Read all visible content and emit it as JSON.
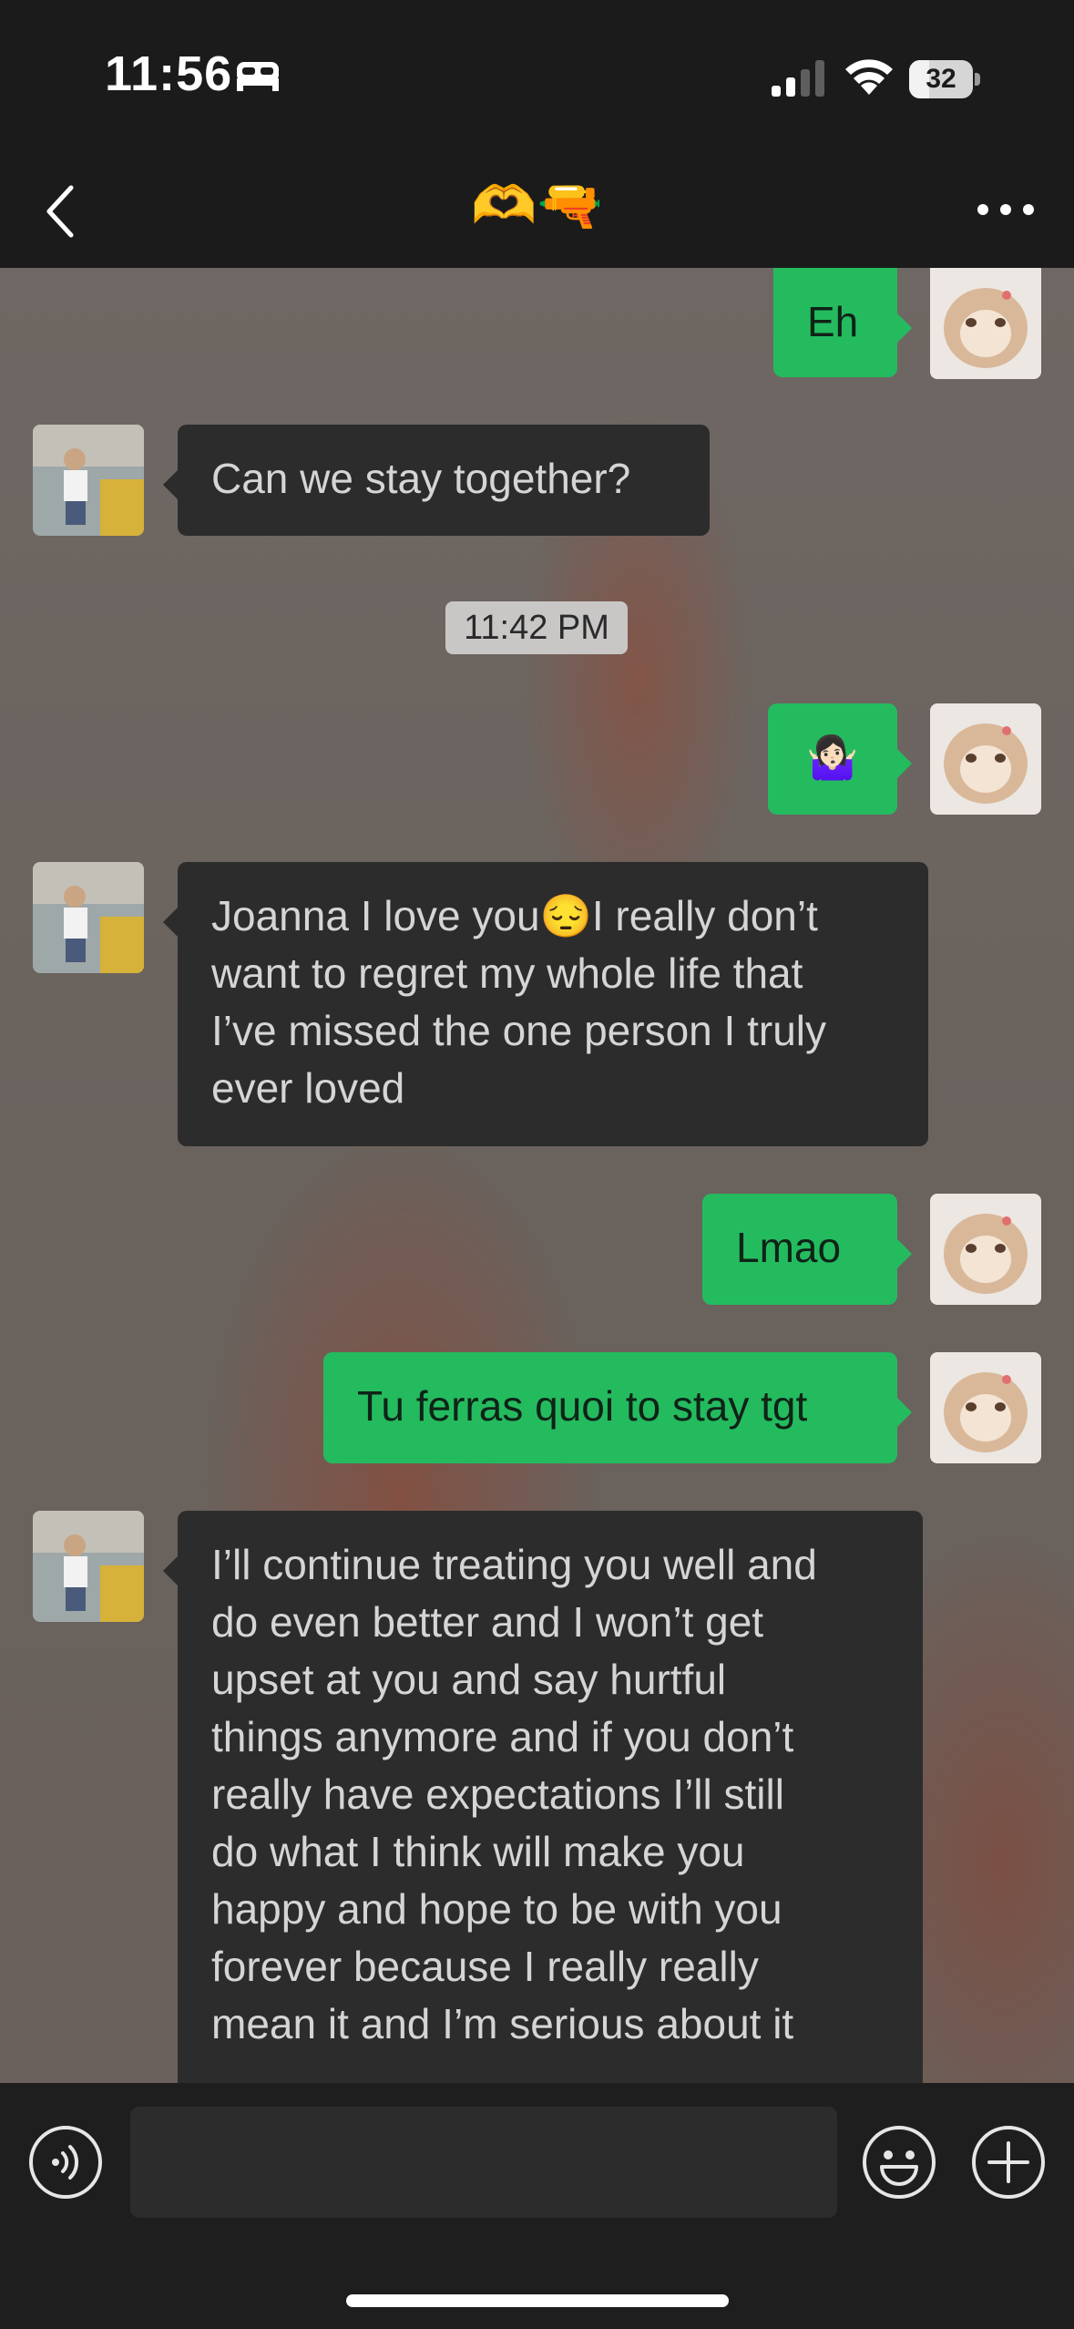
{
  "status_bar": {
    "time": "11:56",
    "battery": "32",
    "battery_percent": 32,
    "icons": [
      "bed-icon",
      "cellular-signal-icon",
      "wifi-icon",
      "battery-icon"
    ]
  },
  "nav": {
    "title": "🫶🔫",
    "back_icon": "chevron-left-icon",
    "more_icon": "more-dots-icon"
  },
  "messages": [
    {
      "from": "me",
      "text": "Eh"
    },
    {
      "from": "them",
      "text": "Can we stay together?"
    },
    {
      "type": "timestamp",
      "text": "11:42 PM"
    },
    {
      "from": "me",
      "text": "🤷🏻‍♀️"
    },
    {
      "from": "them",
      "text": "Joanna I love you😔I really don’t\nwant to regret my whole life that\nI’ve missed the one person I truly\never loved"
    },
    {
      "from": "me",
      "text": "Lmao"
    },
    {
      "from": "me",
      "text": "Tu ferras quoi to stay tgt"
    },
    {
      "from": "them",
      "text": "I’ll continue treating you well and\ndo even better and  I won’t get\nupset at you and say hurtful\nthings anymore and if you don’t\nreally have expectations I’ll still\ndo what I think will make you\nhappy and hope to be with you\nforever because I really really\nmean it and I’m serious about it"
    }
  ],
  "input_bar": {
    "input_value": "",
    "icons": [
      "voice-icon",
      "emoji-icon",
      "plus-icon"
    ]
  },
  "colors": {
    "outgoing_bubble": "#24bb5f",
    "incoming_bubble": "#2c2c2c",
    "bar_background": "#1b1b1b"
  }
}
